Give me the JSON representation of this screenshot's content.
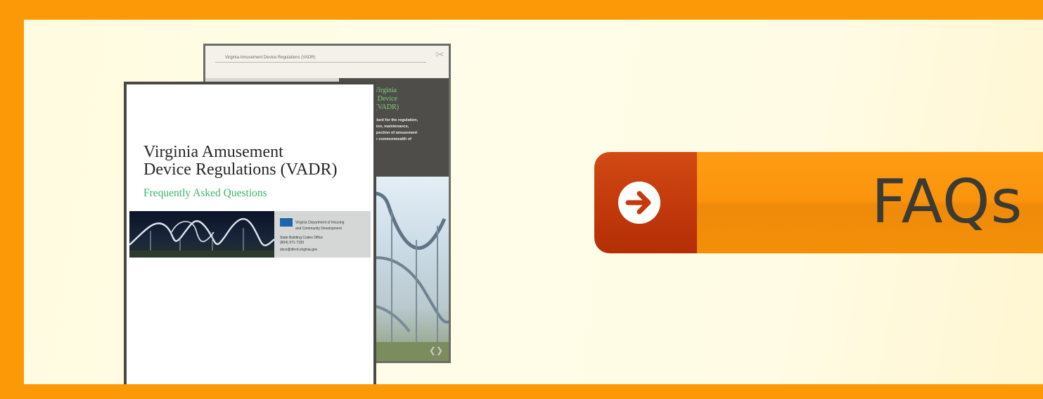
{
  "banner": {
    "colors": {
      "frame": "#fb9a06",
      "panel": "#fffbe2",
      "button_left": "#c33a0c",
      "button_right": "#fb940c",
      "button_text": "#3b3b33"
    }
  },
  "documents": {
    "back": {
      "header_text": "Virginia Amusement Device Regulations (VADR)",
      "heading_lines": [
        "ia Virginia",
        "ent Device",
        "ns (VADR)"
      ],
      "body_lines": [
        "Standard for the regulation,",
        "location, maintenance,",
        "d inspection of amusement",
        "in the commonwealth of"
      ],
      "tools_icon": "scissors-icon",
      "nav_icon": "prev-next-arrows-icon"
    },
    "front": {
      "title_line_1": "Virginia Amusement",
      "title_line_2": "Device Regulations (VADR)",
      "subtitle": "Frequently Asked Questions",
      "info_org_lines": [
        "Virginia Department of Housing",
        "and Community Development"
      ],
      "info_office": "State Building Codes Office",
      "info_phone": "(804) 371-7150",
      "info_email": "sbco@dhcd.virginia.gov"
    }
  },
  "faq_button": {
    "label": "FAQs",
    "icon": "arrow-right-icon"
  }
}
